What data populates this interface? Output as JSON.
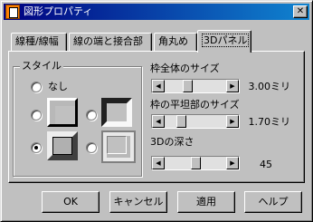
{
  "window": {
    "title": "図形プロパティ",
    "close_glyph": "✕"
  },
  "tabs": [
    {
      "label": "線種/線幅"
    },
    {
      "label": "線の端と接合部"
    },
    {
      "label": "角丸め"
    },
    {
      "label": "3Dパネル",
      "active": true
    }
  ],
  "style_group": {
    "label": "スタイル",
    "options": [
      {
        "label": "なし",
        "checked": false
      },
      {
        "label": "",
        "checked": false
      },
      {
        "label": "",
        "checked": false
      },
      {
        "label": "",
        "checked": true
      },
      {
        "label": "",
        "checked": false
      }
    ]
  },
  "sliders": [
    {
      "label": "枠全体のサイズ",
      "value_text": "3.00ミリ",
      "level": 0.35
    },
    {
      "label": "枠の平坦部のサイズ",
      "value_text": "1.70ミリ",
      "level": 0.22
    },
    {
      "label": "3Dの深さ",
      "value_text": "45",
      "level": 0.5
    }
  ],
  "arrows": {
    "left": "◀",
    "right": "▶"
  },
  "buttons": {
    "ok": "OK",
    "cancel": "キャンセル",
    "apply": "適用",
    "help": "ヘルプ"
  }
}
